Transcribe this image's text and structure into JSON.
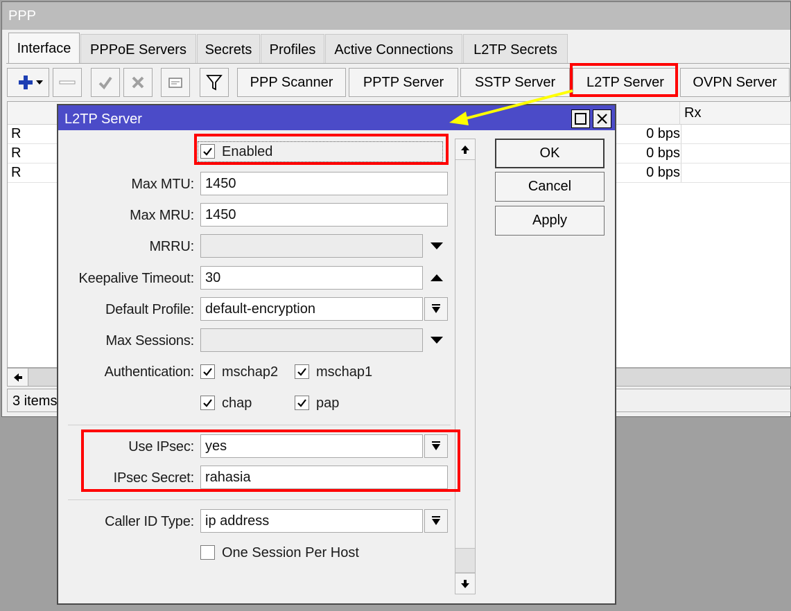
{
  "ppp_window": {
    "title": "PPP",
    "tabs": [
      "Interface",
      "PPPoE Servers",
      "Secrets",
      "Profiles",
      "Active Connections",
      "L2TP Secrets"
    ],
    "toolbar": {
      "buttons": [
        "PPP Scanner",
        "PPTP Server",
        "SSTP Server",
        "L2TP Server",
        "OVPN Server"
      ],
      "icons": [
        "add-icon",
        "remove-icon",
        "enable-icon",
        "disable-icon",
        "comment-icon",
        "filter-icon"
      ]
    },
    "list": {
      "column_rx": "Rx",
      "rows": [
        {
          "flag": "R",
          "tx": "0 bps"
        },
        {
          "flag": "R",
          "tx": "0 bps"
        },
        {
          "flag": "R",
          "tx": "0 bps"
        }
      ]
    },
    "status": "3 items"
  },
  "dialog": {
    "title": "L2TP Server",
    "enabled_label": "Enabled",
    "enabled": true,
    "fields": {
      "max_mtu": {
        "label": "Max MTU:",
        "value": "1450"
      },
      "max_mru": {
        "label": "Max MRU:",
        "value": "1450"
      },
      "mrru": {
        "label": "MRRU:",
        "value": ""
      },
      "keepalive": {
        "label": "Keepalive Timeout:",
        "value": "30"
      },
      "default_profile": {
        "label": "Default Profile:",
        "value": "default-encryption"
      },
      "max_sessions": {
        "label": "Max Sessions:",
        "value": ""
      },
      "authentication": {
        "label": "Authentication:",
        "options": [
          {
            "name": "mschap2",
            "checked": true
          },
          {
            "name": "mschap1",
            "checked": true
          },
          {
            "name": "chap",
            "checked": true
          },
          {
            "name": "pap",
            "checked": true
          }
        ]
      },
      "use_ipsec": {
        "label": "Use IPsec:",
        "value": "yes"
      },
      "ipsec_secret": {
        "label": "IPsec Secret:",
        "value": "rahasia"
      },
      "caller_id_type": {
        "label": "Caller ID Type:",
        "value": "ip address"
      },
      "one_session": {
        "label": "One Session Per Host",
        "checked": false
      }
    },
    "buttons": {
      "ok": "OK",
      "cancel": "Cancel",
      "apply": "Apply"
    }
  },
  "colors": {
    "title_active": "#4b4bc8",
    "highlight": "#ff0000",
    "arrow": "#ffff00"
  }
}
